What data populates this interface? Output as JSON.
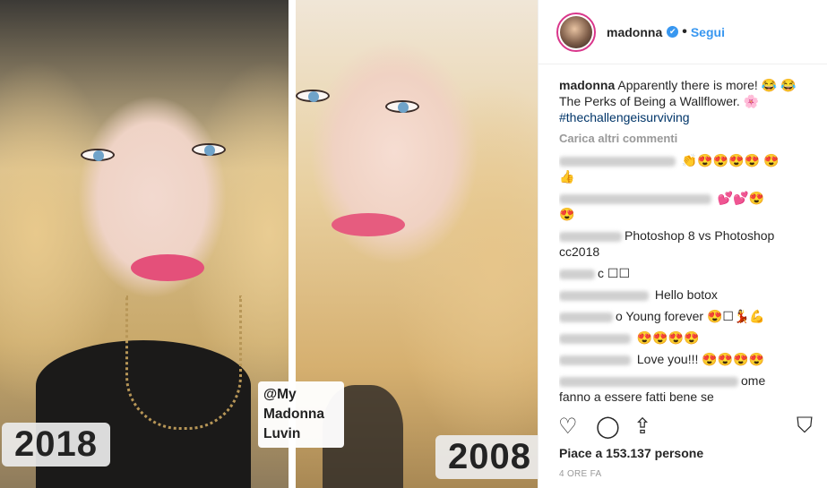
{
  "photo": {
    "year_left": "2018",
    "year_right": "2008",
    "tag_line1": "@My",
    "tag_line2": "Madonna",
    "tag_line3": "Luvin"
  },
  "header": {
    "username": "madonna",
    "verified_icon": "✔",
    "separator": "•",
    "follow_label": "Segui"
  },
  "caption": {
    "username": "madonna",
    "text": " Apparently there is more! 😂 😂 The Perks of Being a Wallflower. 🌸 ",
    "hashtag": "#thechallengeisurviving"
  },
  "load_more": "Carica altri commenti",
  "comments": [
    {
      "text": " 👏😍😍😍😍 😍👍",
      "blur_width": 130
    },
    {
      "text": " 💕💕😍 😍",
      "blur_width": 170
    },
    {
      "text": "Photoshop 8 vs Photoshop cc2018",
      "blur_width": 70
    },
    {
      "text": "c ☐☐",
      "blur_width": 40
    },
    {
      "text": " Hello botox",
      "blur_width": 100
    },
    {
      "text": "o Young forever 😍☐💃💪",
      "blur_width": 60
    },
    {
      "text": " 😍😍😍😍",
      "blur_width": 80
    },
    {
      "text": " Love you!!! 😍😍😍😍",
      "blur_width": 80
    },
    {
      "text": "ome fanno a essere fatti bene se",
      "blur_width": 200
    }
  ],
  "likes": "Piace a 153.137 persone",
  "time": "4 ORE FA",
  "icons": {
    "like": "heart-icon",
    "comment": "comment-icon",
    "share": "share-icon",
    "save": "bookmark-icon"
  },
  "colors": {
    "accent": "#3897f0",
    "hashtag": "#003569",
    "muted": "#999999"
  }
}
